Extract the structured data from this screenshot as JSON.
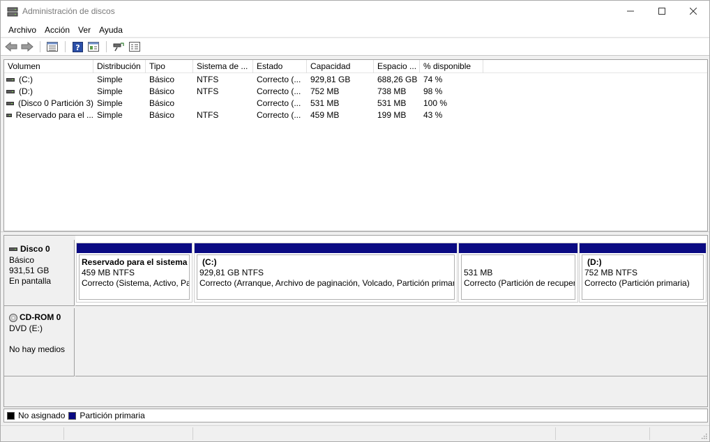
{
  "window": {
    "title": "Administración de discos"
  },
  "menu": {
    "items": [
      "Archivo",
      "Acción",
      "Ver",
      "Ayuda"
    ]
  },
  "toolbar": {
    "buttons": [
      "back-icon",
      "forward-icon",
      "properties-list-icon",
      "help-icon",
      "view-panel-icon",
      "rescan-icon",
      "disk-list-icon"
    ]
  },
  "list": {
    "columns": [
      "Volumen",
      "Distribución",
      "Tipo",
      "Sistema de ...",
      "Estado",
      "Capacidad",
      "Espacio ...",
      "% disponible"
    ],
    "rows": [
      {
        "volumen": "(C:)",
        "distribucion": "Simple",
        "tipo": "Básico",
        "sistema": "NTFS",
        "estado": "Correcto (...",
        "capacidad": "929,81 GB",
        "espacio": "688,26 GB",
        "disponible": "74 %"
      },
      {
        "volumen": "(D:)",
        "distribucion": "Simple",
        "tipo": "Básico",
        "sistema": "NTFS",
        "estado": "Correcto (...",
        "capacidad": "752 MB",
        "espacio": "738 MB",
        "disponible": "98 %"
      },
      {
        "volumen": "(Disco 0 Partición 3)",
        "distribucion": "Simple",
        "tipo": "Básico",
        "sistema": "",
        "estado": "Correcto (...",
        "capacidad": "531 MB",
        "espacio": "531 MB",
        "disponible": "100 %"
      },
      {
        "volumen": "Reservado para el ...",
        "distribucion": "Simple",
        "tipo": "Básico",
        "sistema": "NTFS",
        "estado": "Correcto (...",
        "capacidad": "459 MB",
        "espacio": "199 MB",
        "disponible": "43 %"
      }
    ]
  },
  "disks": [
    {
      "name": "Disco 0",
      "type": "Básico",
      "size": "931,51 GB",
      "status": "En pantalla",
      "partitions": [
        {
          "title": "Reservado para el sistema",
          "size": "459 MB NTFS",
          "status": "Correcto (Sistema, Activo, Partición primaria)"
        },
        {
          "title": "(C:)",
          "size": "929,81 GB NTFS",
          "status": "Correcto (Arranque, Archivo de paginación, Volcado, Partición primaria)"
        },
        {
          "title": "",
          "size": "531 MB",
          "status": "Correcto (Partición de recuperación)"
        },
        {
          "title": "(D:)",
          "size": "752 MB NTFS",
          "status": "Correcto (Partición primaria)"
        }
      ]
    },
    {
      "name": "CD-ROM 0",
      "type": "DVD (E:)",
      "size": "",
      "status": "No hay medios"
    }
  ],
  "legend": {
    "items": [
      {
        "label": "No asignado",
        "color": "#000000"
      },
      {
        "label": "Partición primaria",
        "color": "#0a0a82"
      }
    ]
  },
  "colors": {
    "partition_bar": "#0a0a82",
    "unallocated": "#000000"
  }
}
